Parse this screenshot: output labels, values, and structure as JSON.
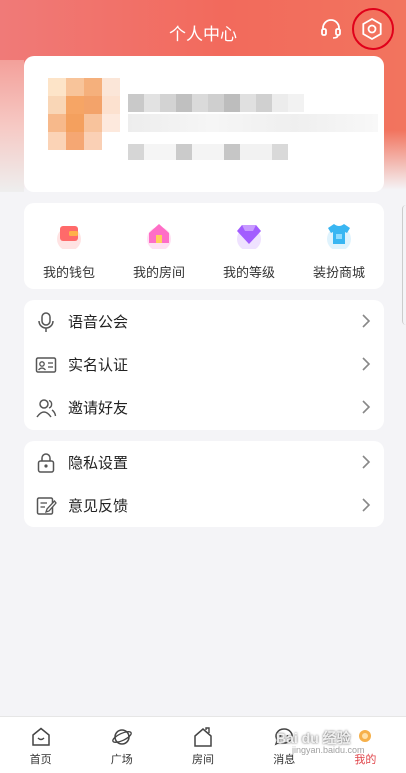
{
  "header": {
    "title": "个人中心"
  },
  "quick_actions": [
    {
      "label": "我的钱包",
      "icon": "wallet-icon",
      "color": "#ff6a6a"
    },
    {
      "label": "我的房间",
      "icon": "home-icon",
      "color": "#ff6ec7"
    },
    {
      "label": "我的等级",
      "icon": "diamond-icon",
      "color": "#a25cff"
    },
    {
      "label": "装扮商城",
      "icon": "shirt-icon",
      "color": "#39b6f2"
    }
  ],
  "menu_group_1": [
    {
      "label": "语音公会",
      "icon": "microphone-icon"
    },
    {
      "label": "实名认证",
      "icon": "id-card-icon"
    },
    {
      "label": "邀请好友",
      "icon": "invite-friends-icon"
    }
  ],
  "menu_group_2": [
    {
      "label": "隐私设置",
      "icon": "lock-icon"
    },
    {
      "label": "意见反馈",
      "icon": "feedback-icon"
    }
  ],
  "tabbar": [
    {
      "label": "首页",
      "icon": "home-tab-icon",
      "active": false
    },
    {
      "label": "广场",
      "icon": "planet-icon",
      "active": false
    },
    {
      "label": "房间",
      "icon": "room-icon",
      "active": false
    },
    {
      "label": "消息",
      "icon": "message-icon",
      "active": false
    },
    {
      "label": "我的",
      "icon": "profile-icon",
      "active": true
    }
  ],
  "watermark": {
    "text": "Bai du 经验",
    "sub": "jingyan.baidu.com"
  },
  "colors": {
    "accent": "#e0454a",
    "header": "#f26a5c",
    "highlight_ring": "#e0001a"
  }
}
